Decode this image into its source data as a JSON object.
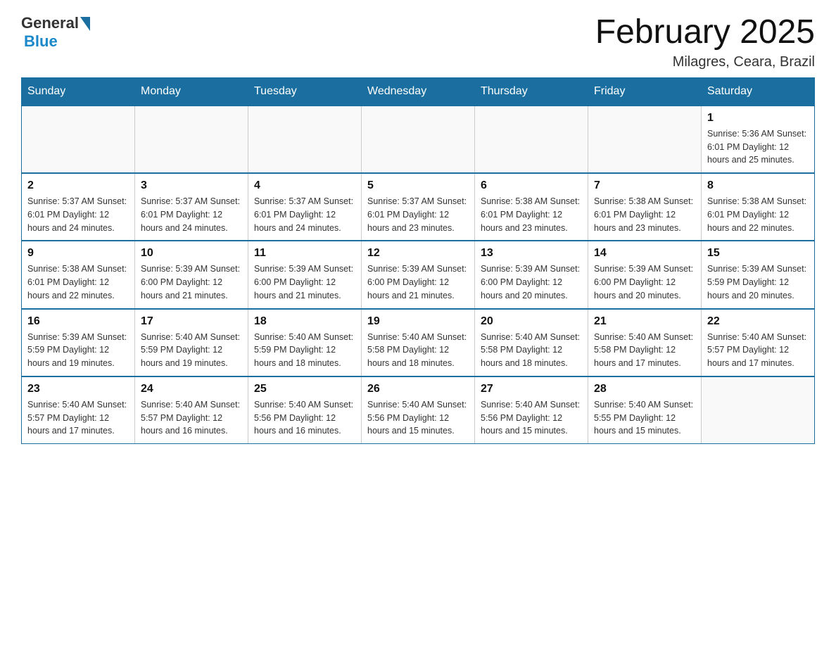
{
  "logo": {
    "general": "General",
    "blue": "Blue"
  },
  "title": "February 2025",
  "location": "Milagres, Ceara, Brazil",
  "days_of_week": [
    "Sunday",
    "Monday",
    "Tuesday",
    "Wednesday",
    "Thursday",
    "Friday",
    "Saturday"
  ],
  "weeks": [
    [
      {
        "day": "",
        "info": ""
      },
      {
        "day": "",
        "info": ""
      },
      {
        "day": "",
        "info": ""
      },
      {
        "day": "",
        "info": ""
      },
      {
        "day": "",
        "info": ""
      },
      {
        "day": "",
        "info": ""
      },
      {
        "day": "1",
        "info": "Sunrise: 5:36 AM\nSunset: 6:01 PM\nDaylight: 12 hours and 25 minutes."
      }
    ],
    [
      {
        "day": "2",
        "info": "Sunrise: 5:37 AM\nSunset: 6:01 PM\nDaylight: 12 hours and 24 minutes."
      },
      {
        "day": "3",
        "info": "Sunrise: 5:37 AM\nSunset: 6:01 PM\nDaylight: 12 hours and 24 minutes."
      },
      {
        "day": "4",
        "info": "Sunrise: 5:37 AM\nSunset: 6:01 PM\nDaylight: 12 hours and 24 minutes."
      },
      {
        "day": "5",
        "info": "Sunrise: 5:37 AM\nSunset: 6:01 PM\nDaylight: 12 hours and 23 minutes."
      },
      {
        "day": "6",
        "info": "Sunrise: 5:38 AM\nSunset: 6:01 PM\nDaylight: 12 hours and 23 minutes."
      },
      {
        "day": "7",
        "info": "Sunrise: 5:38 AM\nSunset: 6:01 PM\nDaylight: 12 hours and 23 minutes."
      },
      {
        "day": "8",
        "info": "Sunrise: 5:38 AM\nSunset: 6:01 PM\nDaylight: 12 hours and 22 minutes."
      }
    ],
    [
      {
        "day": "9",
        "info": "Sunrise: 5:38 AM\nSunset: 6:01 PM\nDaylight: 12 hours and 22 minutes."
      },
      {
        "day": "10",
        "info": "Sunrise: 5:39 AM\nSunset: 6:00 PM\nDaylight: 12 hours and 21 minutes."
      },
      {
        "day": "11",
        "info": "Sunrise: 5:39 AM\nSunset: 6:00 PM\nDaylight: 12 hours and 21 minutes."
      },
      {
        "day": "12",
        "info": "Sunrise: 5:39 AM\nSunset: 6:00 PM\nDaylight: 12 hours and 21 minutes."
      },
      {
        "day": "13",
        "info": "Sunrise: 5:39 AM\nSunset: 6:00 PM\nDaylight: 12 hours and 20 minutes."
      },
      {
        "day": "14",
        "info": "Sunrise: 5:39 AM\nSunset: 6:00 PM\nDaylight: 12 hours and 20 minutes."
      },
      {
        "day": "15",
        "info": "Sunrise: 5:39 AM\nSunset: 5:59 PM\nDaylight: 12 hours and 20 minutes."
      }
    ],
    [
      {
        "day": "16",
        "info": "Sunrise: 5:39 AM\nSunset: 5:59 PM\nDaylight: 12 hours and 19 minutes."
      },
      {
        "day": "17",
        "info": "Sunrise: 5:40 AM\nSunset: 5:59 PM\nDaylight: 12 hours and 19 minutes."
      },
      {
        "day": "18",
        "info": "Sunrise: 5:40 AM\nSunset: 5:59 PM\nDaylight: 12 hours and 18 minutes."
      },
      {
        "day": "19",
        "info": "Sunrise: 5:40 AM\nSunset: 5:58 PM\nDaylight: 12 hours and 18 minutes."
      },
      {
        "day": "20",
        "info": "Sunrise: 5:40 AM\nSunset: 5:58 PM\nDaylight: 12 hours and 18 minutes."
      },
      {
        "day": "21",
        "info": "Sunrise: 5:40 AM\nSunset: 5:58 PM\nDaylight: 12 hours and 17 minutes."
      },
      {
        "day": "22",
        "info": "Sunrise: 5:40 AM\nSunset: 5:57 PM\nDaylight: 12 hours and 17 minutes."
      }
    ],
    [
      {
        "day": "23",
        "info": "Sunrise: 5:40 AM\nSunset: 5:57 PM\nDaylight: 12 hours and 17 minutes."
      },
      {
        "day": "24",
        "info": "Sunrise: 5:40 AM\nSunset: 5:57 PM\nDaylight: 12 hours and 16 minutes."
      },
      {
        "day": "25",
        "info": "Sunrise: 5:40 AM\nSunset: 5:56 PM\nDaylight: 12 hours and 16 minutes."
      },
      {
        "day": "26",
        "info": "Sunrise: 5:40 AM\nSunset: 5:56 PM\nDaylight: 12 hours and 15 minutes."
      },
      {
        "day": "27",
        "info": "Sunrise: 5:40 AM\nSunset: 5:56 PM\nDaylight: 12 hours and 15 minutes."
      },
      {
        "day": "28",
        "info": "Sunrise: 5:40 AM\nSunset: 5:55 PM\nDaylight: 12 hours and 15 minutes."
      },
      {
        "day": "",
        "info": ""
      }
    ]
  ]
}
